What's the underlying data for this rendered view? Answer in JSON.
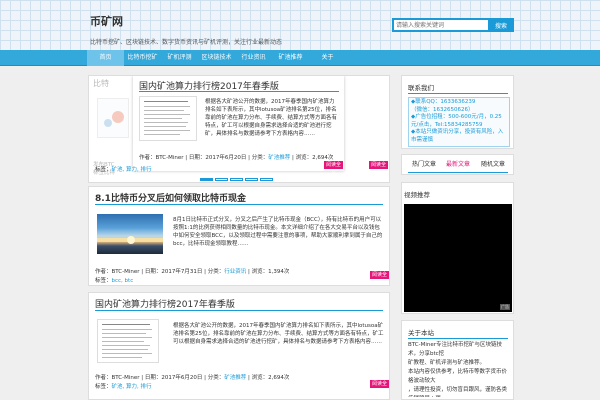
{
  "site": {
    "title": "币矿网",
    "description": "比特币挖矿、区块链技术、数字货币资讯与矿机评测，关注行业最新动态"
  },
  "search": {
    "placeholder": "请输入搜索关键词",
    "button": "搜索"
  },
  "nav": {
    "items": [
      {
        "label": "首页",
        "active": true
      },
      {
        "label": "比特币挖矿",
        "active": false
      },
      {
        "label": "矿机评测",
        "active": false
      },
      {
        "label": "区块链技术",
        "active": false
      },
      {
        "label": "行业资讯",
        "active": false
      },
      {
        "label": "矿池推荐",
        "active": false
      },
      {
        "label": "关于",
        "active": false
      }
    ]
  },
  "slider": {
    "ghost_left_title": "比特",
    "ghost_left_meta": "发布BTC",
    "ghost_left_tags": "标签比特",
    "slide": {
      "title": "国内矿池算力排行榜2017年春季版",
      "excerpt": "根据各大矿池公开的数据，2017年春季国内矿池算力排名如下表所示，其中lotusoa矿池排名第25位，排名靠前的矿池在算力分布、手续费、结算方式等方面各有特点，矿工可以根据自身需求选择合适的矿池进行挖矿，具体排名与数据请参考下方表格内容……",
      "meta_prefix": "作者：BTC-Miner | 日期：2017年6月20日 | 分类：",
      "meta_category": "矿池推荐",
      "meta_suffix": " | 浏览：2,694次",
      "tags_label": "标签：",
      "tags": "矿池, 算力, 排行",
      "read_more": "阅读全文"
    },
    "dots": [
      true,
      false,
      false,
      false,
      false
    ]
  },
  "posts": [
    {
      "title": "8.1比特币分叉后如何领取比特币现金",
      "excerpt": "8月1日比特币正式分叉，分叉之后产生了比特币现金（BCC），持有比特币的用户可以按照1:1的比例获得相同数量的比特币现金。本文详细介绍了在各大交易平台以及钱包中如何安全领取BCC，以及领取过程中需要注意的事项，帮助大家顺利拿到属于自己的bcc，比特币现金领取教程……",
      "meta_prefix": "作者：BTC-Miner | 日期：2017年7月31日 | 分类：",
      "meta_category": "行业资讯",
      "meta_suffix": " | 浏览：1,394次",
      "tags_label": "标签：",
      "tags": "bcc, btc",
      "read_more": "阅读全文"
    },
    {
      "title": "国内矿池算力排行榜2017年春季版",
      "excerpt": "根据各大矿池公开的数据，2017年春季国内矿池算力排名如下表所示，其中lotusoa矿池排名第25位，排名靠前的矿池在算力分布、手续费、结算方式等方面各有特点，矿工可以根据自身需求选择合适的矿池进行挖矿，具体排名与数据请参考下方表格内容……",
      "meta_prefix": "作者：BTC-Miner | 日期：2017年6月20日 | 分类：",
      "meta_category": "矿池推荐",
      "meta_suffix": " | 浏览：2,694次",
      "tags_label": "标签：",
      "tags": "矿池, 算力, 排行",
      "read_more": "阅读全文"
    }
  ],
  "sidebar": {
    "contact": {
      "title": "联系我们",
      "lines": [
        "◆联系QQ：1633636239",
        "（微信：1632650626）",
        "◆广告位招租：500-600元/月，0.25元/点击，Tel:15834285759",
        "◆本站只做资讯分享，投资有风险，入市需谨慎"
      ]
    },
    "tabs": [
      {
        "label": "热门文章",
        "active": false
      },
      {
        "label": "最新文章",
        "active": true
      },
      {
        "label": "随机文章",
        "active": false
      }
    ],
    "video": {
      "title": "视频推荐",
      "badge": "广告"
    },
    "about": {
      "title": "关于本站",
      "lines": [
        "BTC-Miner专注比特币挖矿与区块链技术，分享btc挖",
        "矿教程、矿机评测与矿池推荐。",
        "本站内容仅供参考，比特币等数字货币价格波动较大",
        "，请理性投资，切勿盲目跟风，谨防各类传销骗局 | 更"
      ]
    }
  },
  "colors": {
    "accent": "#1a9bd7",
    "nav": "#33a8db",
    "read_more": "#e5157a"
  }
}
